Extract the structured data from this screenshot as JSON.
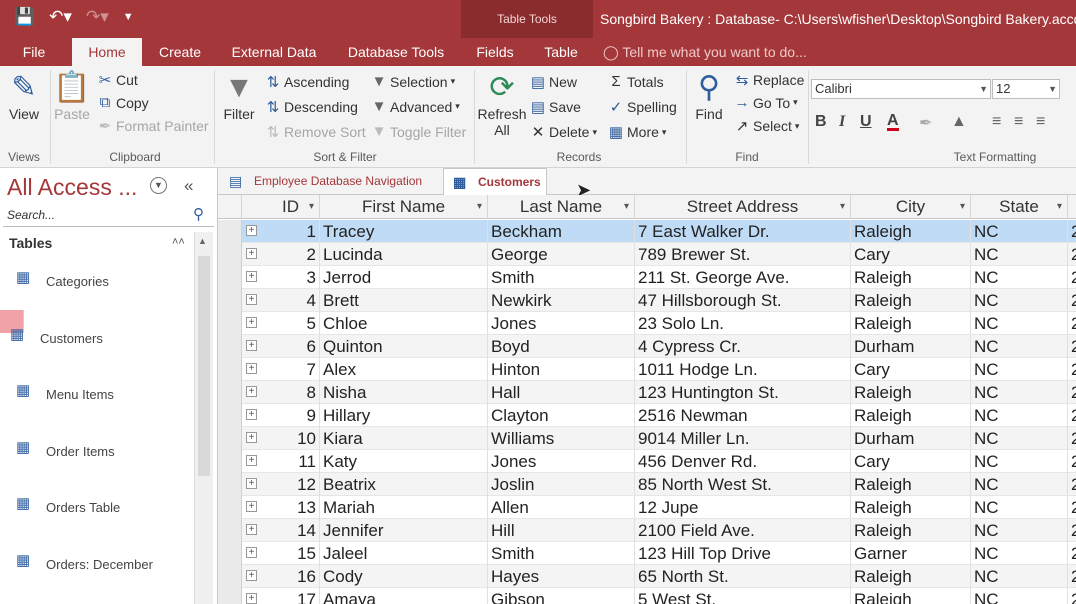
{
  "window": {
    "title": "Songbird Bakery : Database- C:\\Users\\wfisher\\Desktop\\Songbird Bakery.accdb",
    "context_tab_group": "Table Tools"
  },
  "ribbon_tabs": [
    "File",
    "Home",
    "Create",
    "External Data",
    "Database Tools",
    "Fields",
    "Table"
  ],
  "tell_me": "Tell me what you want to do...",
  "ribbon": {
    "views": {
      "view": "View",
      "group": "Views"
    },
    "clipboard": {
      "paste": "Paste",
      "cut": "Cut",
      "copy": "Copy",
      "format_painter": "Format Painter",
      "group": "Clipboard"
    },
    "sort_filter": {
      "filter": "Filter",
      "ascending": "Ascending",
      "descending": "Descending",
      "remove_sort": "Remove Sort",
      "selection": "Selection",
      "advanced": "Advanced",
      "toggle_filter": "Toggle Filter",
      "group": "Sort & Filter"
    },
    "records": {
      "refresh": "Refresh",
      "refresh_all": "All",
      "new": "New",
      "save": "Save",
      "delete": "Delete",
      "totals": "Totals",
      "spelling": "Spelling",
      "more": "More",
      "group": "Records"
    },
    "find": {
      "find": "Find",
      "replace": "Replace",
      "goto": "Go To",
      "select": "Select",
      "group": "Find"
    },
    "text_formatting": {
      "font": "Calibri",
      "size": "12",
      "group": "Text Formatting"
    }
  },
  "nav": {
    "title": "All Access ...",
    "search_placeholder": "Search...",
    "section": "Tables",
    "items": [
      "Categories",
      "Customers",
      "Menu Items",
      "Order Items",
      "Orders Table",
      "Orders: December"
    ],
    "selected": "Customers"
  },
  "doc_tabs": [
    "Employee Database Navigation",
    "Customers"
  ],
  "table": {
    "columns": [
      "ID",
      "First Name",
      "Last Name",
      "Street Address",
      "City",
      "State"
    ],
    "rows": [
      [
        "1",
        "Tracey",
        "Beckham",
        "7 East Walker Dr.",
        "Raleigh",
        "NC",
        "2"
      ],
      [
        "2",
        "Lucinda",
        "George",
        "789 Brewer St.",
        "Cary",
        "NC",
        "2"
      ],
      [
        "3",
        "Jerrod",
        "Smith",
        "211 St. George Ave.",
        "Raleigh",
        "NC",
        "2"
      ],
      [
        "4",
        "Brett",
        "Newkirk",
        "47 Hillsborough St.",
        "Raleigh",
        "NC",
        "2"
      ],
      [
        "5",
        "Chloe",
        "Jones",
        "23 Solo Ln.",
        "Raleigh",
        "NC",
        "2"
      ],
      [
        "6",
        "Quinton",
        "Boyd",
        "4 Cypress Cr.",
        "Durham",
        "NC",
        "2"
      ],
      [
        "7",
        "Alex",
        "Hinton",
        "1011 Hodge Ln.",
        "Cary",
        "NC",
        "2"
      ],
      [
        "8",
        "Nisha",
        "Hall",
        "123 Huntington St.",
        "Raleigh",
        "NC",
        "2"
      ],
      [
        "9",
        "Hillary",
        "Clayton",
        "2516 Newman",
        "Raleigh",
        "NC",
        "2"
      ],
      [
        "10",
        "Kiara",
        "Williams",
        "9014 Miller Ln.",
        "Durham",
        "NC",
        "2"
      ],
      [
        "11",
        "Katy",
        "Jones",
        "456 Denver Rd.",
        "Cary",
        "NC",
        "2"
      ],
      [
        "12",
        "Beatrix",
        "Joslin",
        "85 North West St.",
        "Raleigh",
        "NC",
        "2"
      ],
      [
        "13",
        "Mariah",
        "Allen",
        "12 Jupe",
        "Raleigh",
        "NC",
        "2"
      ],
      [
        "14",
        "Jennifer",
        "Hill",
        "2100 Field Ave.",
        "Raleigh",
        "NC",
        "2"
      ],
      [
        "15",
        "Jaleel",
        "Smith",
        "123 Hill Top Drive",
        "Garner",
        "NC",
        "2"
      ],
      [
        "16",
        "Cody",
        "Hayes",
        "65 North St.",
        "Raleigh",
        "NC",
        "2"
      ],
      [
        "17",
        "Amaya",
        "Gibson",
        "5 West St.",
        "Raleigh",
        "NC",
        "2"
      ]
    ]
  },
  "colors": {
    "accent": "#a4373a",
    "selected_nav": "#f0a2a8",
    "current_row": "#bfdbf5"
  }
}
